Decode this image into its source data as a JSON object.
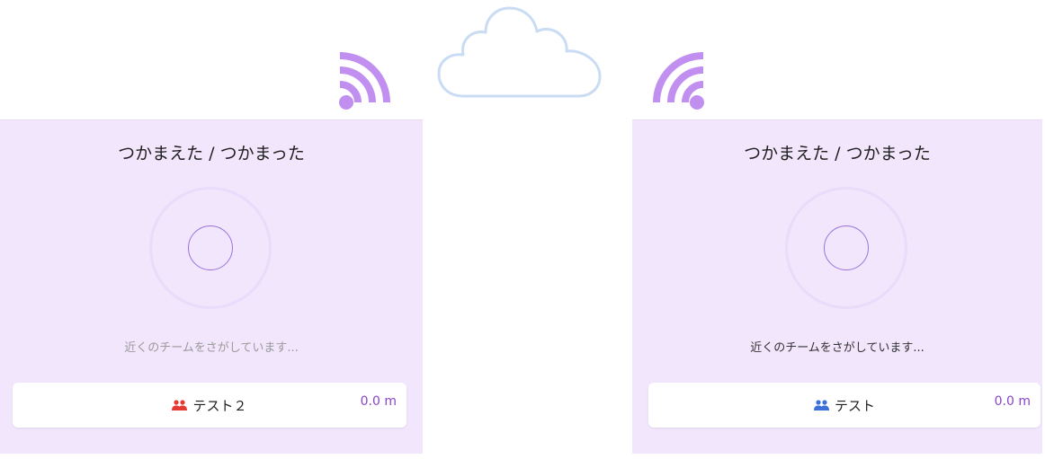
{
  "left_device": {
    "title": "つかまえた / つかまった",
    "status": "近くのチームをさがしています...",
    "team": {
      "name": "テスト２",
      "distance": "0.0 m",
      "icon": "group-icon",
      "icon_color": "#e53935"
    }
  },
  "right_device": {
    "title": "つかまえた / つかまった",
    "status": "近くのチームをさがしています...",
    "team": {
      "name": "テスト",
      "distance": "0.0 m",
      "icon": "group-icon",
      "icon_color": "#3d6fd9"
    }
  },
  "colors": {
    "panel_bg": "#f2e6fd",
    "accent": "#8a45c6",
    "signal": "#c08ff0",
    "cloud": "#c9dcf4"
  },
  "icons": [
    "cloud-icon",
    "wifi-signal-icon",
    "group-icon"
  ]
}
